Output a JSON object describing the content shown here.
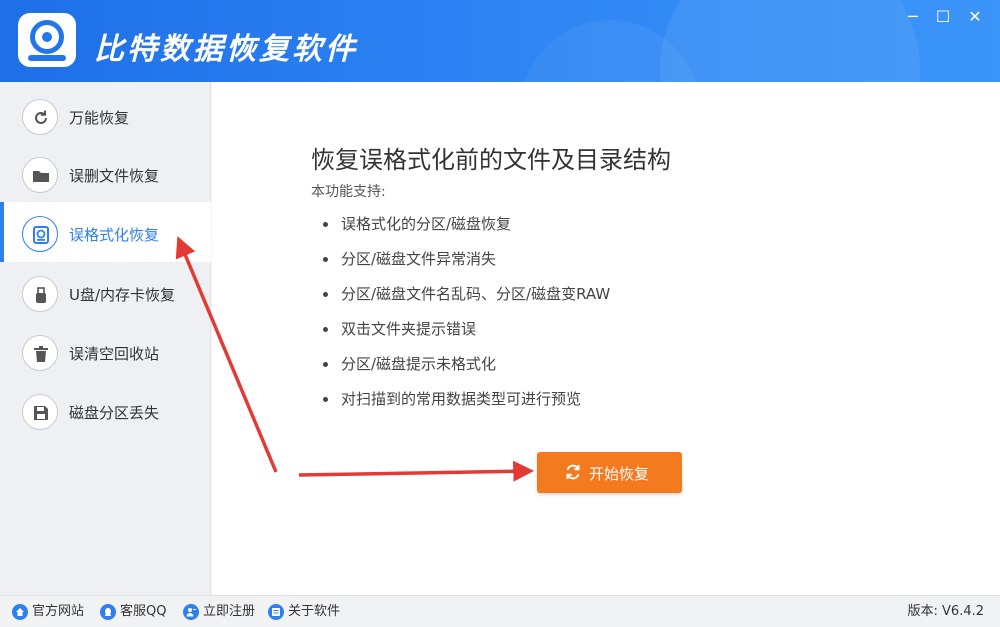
{
  "window": {
    "title": "比特数据恢复软件",
    "controls": {
      "minimize": "─",
      "maximize": "☐",
      "close": "✕"
    }
  },
  "sidebar": {
    "items": [
      {
        "label": "万能恢复",
        "icon": "refresh-icon",
        "active": false
      },
      {
        "label": "误删文件恢复",
        "icon": "folder-icon",
        "active": false
      },
      {
        "label": "误格式化恢复",
        "icon": "format-disk-icon",
        "active": true
      },
      {
        "label": "U盘/内存卡恢复",
        "icon": "usb-icon",
        "active": false
      },
      {
        "label": "误清空回收站",
        "icon": "trash-icon",
        "active": false
      },
      {
        "label": "磁盘分区丢失",
        "icon": "save-disk-icon",
        "active": false
      }
    ]
  },
  "main": {
    "heading": "恢复误格式化前的文件及目录结构",
    "support_label": "本功能支持:",
    "features": [
      "误格式化的分区/磁盘恢复",
      "分区/磁盘文件异常消失",
      "分区/磁盘文件名乱码、分区/磁盘变RAW",
      "双击文件夹提示错误",
      "分区/磁盘提示未格式化",
      "对扫描到的常用数据类型可进行预览"
    ],
    "start_button": "开始恢复"
  },
  "statusbar": {
    "links": [
      {
        "label": "官方网站",
        "icon": "home-icon"
      },
      {
        "label": "客服QQ",
        "icon": "qq-icon"
      },
      {
        "label": "立即注册",
        "icon": "register-icon"
      },
      {
        "label": "关于软件",
        "icon": "info-icon"
      }
    ],
    "version": "版本: V6.4.2"
  },
  "colors": {
    "accent": "#2f80ed",
    "title_bar": "#2478ee",
    "start_button": "#f47a1f",
    "annotation_arrow": "#e53935"
  }
}
